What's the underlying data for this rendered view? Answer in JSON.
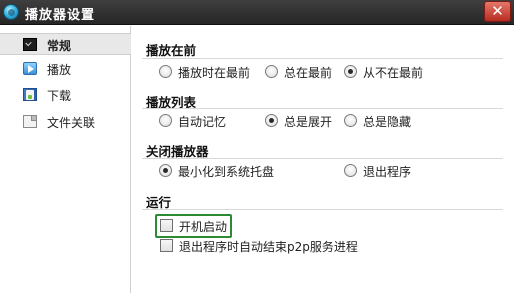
{
  "window": {
    "title": "播放器设置",
    "close": "✕"
  },
  "sidebar": {
    "items": [
      {
        "label": "常规",
        "icon": "terminal-icon",
        "selected": true
      },
      {
        "label": "播放",
        "icon": "play-icon",
        "selected": false
      },
      {
        "label": "下载",
        "icon": "download-icon",
        "selected": false
      },
      {
        "label": "文件关联",
        "icon": "file-icon",
        "selected": false
      }
    ]
  },
  "sections": {
    "play_on_top": {
      "title": "播放在前",
      "options": [
        {
          "label": "播放时在最前",
          "checked": false
        },
        {
          "label": "总在最前",
          "checked": false
        },
        {
          "label": "从不在最前",
          "checked": true
        }
      ]
    },
    "playlist": {
      "title": "播放列表",
      "options": [
        {
          "label": "自动记忆",
          "checked": false
        },
        {
          "label": "总是展开",
          "checked": true
        },
        {
          "label": "总是隐藏",
          "checked": false
        }
      ]
    },
    "close_player": {
      "title": "关闭播放器",
      "options": [
        {
          "label": "最小化到系统托盘",
          "checked": true
        },
        {
          "label": "退出程序",
          "checked": false
        }
      ]
    },
    "run": {
      "title": "运行",
      "checks": [
        {
          "label": "开机启动",
          "checked": false
        },
        {
          "label": "退出程序时自动结束p2p服务进程",
          "checked": false
        }
      ]
    }
  },
  "colors": {
    "titlebar": "#2f2f2f",
    "close": "#c9473a",
    "highlight": "#2c8a35"
  }
}
